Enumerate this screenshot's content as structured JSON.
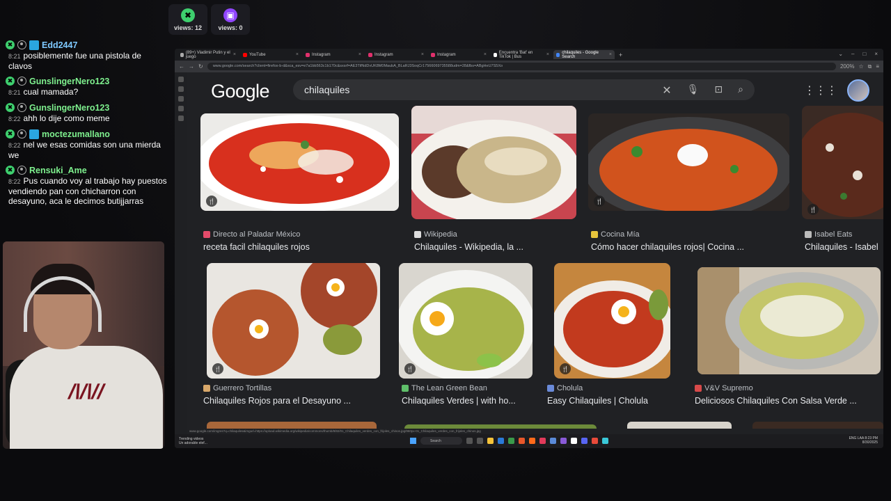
{
  "views": [
    {
      "label": "views: 12",
      "color": "#3ecf6e",
      "glyph": "✖"
    },
    {
      "label": "views: 0",
      "color": "#9146ff",
      "glyph": "▣"
    }
  ],
  "chat": [
    {
      "user": "Edd2447",
      "user_color": "blue",
      "time": "8:21",
      "text": "posiblemente fue una pistola de clavos"
    },
    {
      "user": "GunslingerNero123",
      "user_color": "green",
      "time": "8:21",
      "text": "cual mamada?"
    },
    {
      "user": "GunslingerNero123",
      "user_color": "green",
      "time": "8:22",
      "text": "ahh lo dije como meme"
    },
    {
      "user": "moctezumallano",
      "user_color": "green",
      "time": "8:22",
      "text": "nel we esas comidas son una mierda we"
    },
    {
      "user": "Rensuki_Ame",
      "user_color": "green",
      "time": "8:22",
      "text": "Pus cuando voy al trabajo hay puestos vendiendo pan con chicharron con desayuno, aca le decimos butijjarras"
    }
  ],
  "browser": {
    "tabs": [
      {
        "label": "(89+) Vladimir Putin y el juego",
        "fav": "#aaa"
      },
      {
        "label": "YouTube",
        "fav": "#ff0000"
      },
      {
        "label": "Instagram",
        "fav": "#e1306c"
      },
      {
        "label": "Instagram",
        "fav": "#e1306c"
      },
      {
        "label": "Instagram",
        "fav": "#e1306c"
      },
      {
        "label": "Encuentra 'Bat' en TikTok | Bus",
        "fav": "#fff"
      },
      {
        "label": "chilaquiles - Google Search",
        "fav": "#4285f4",
        "active": true
      }
    ],
    "newtab": "+",
    "url": "www.google.com/search?client=firefox-b-d&sca_esv=e7a1bb563c1b170c&sxsrf=AE3TifNdDvUK8M0MaubA_BLaRJ3SoqCr17566069735588udm=28&fbs=ABgHeU7S5Xo",
    "zoom": "200%"
  },
  "google": {
    "logo": "Google",
    "query": "chilaquiles"
  },
  "results": [
    {
      "source": "Directo al Paladar México",
      "title": "receta facil chilaquiles rojos",
      "fav": "#e34b6a"
    },
    {
      "source": "Wikipedia",
      "title": "Chilaquiles - Wikipedia, la ...",
      "fav": "#ddd"
    },
    {
      "source": "Cocina Mía",
      "title": "Cómo hacer chilaquiles rojos| Cocina ...",
      "fav": "#e6c43c"
    },
    {
      "source": "Isabel Eats",
      "title": "Chilaquiles - Isabel",
      "fav": "#bbb"
    },
    {
      "source": "Guerrero Tortillas",
      "title": "Chilaquiles Rojos para el Desayuno ...",
      "fav": "#d8a86a"
    },
    {
      "source": "The Lean Green Bean",
      "title": "Chilaquiles Verdes | with ho...",
      "fav": "#5fbf6a"
    },
    {
      "source": "Cholula",
      "title": "Easy Chilaquiles | Cholula",
      "fav": "#6a8ad8"
    },
    {
      "source": "V&V Supremo",
      "title": "Deliciosos Chilaquiles Con Salsa Verde ...",
      "fav": "#d84a4a"
    }
  ],
  "status_url": "www.google.com/imgres?q=chilaquiles&imgurl=https://upload.wikimedia.org/wikipedia/commons/thumb/8/82/01_Chilaquiles_verdes_con_frijoles_chinos.jpg/960px-01_Chilaquiles_verdes_con_frijoles_chinos.jpg",
  "taskbar": {
    "trend_title": "Trending videos",
    "trend_sub": "Un adorable elef...",
    "search": "Search",
    "tray_lang": "ENG LAA",
    "clock_time": "8:23 PM",
    "clock_date": "8/30/2025"
  }
}
